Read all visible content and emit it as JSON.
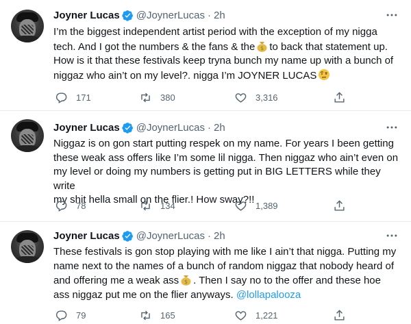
{
  "tweets": [
    {
      "author": "Joyner Lucas",
      "handle": "@JoynerLucas",
      "separator": "·",
      "time": "2h",
      "line1": "I’m the biggest independent artist period with the exception of my nigga",
      "line2_pre": "tech. And I got the numbers & the fans & the",
      "line2_post": "to back that statement up.",
      "line3": "How is it that these festivals keep tryna bunch my name up with a bunch of",
      "line4": "niggaz who ain’t on my level?. nigga I’m JOYNER LUCAS",
      "replies": "171",
      "retweets": "380",
      "likes": "3,316"
    },
    {
      "author": "Joyner Lucas",
      "handle": "@JoynerLucas",
      "separator": "·",
      "time": "2h",
      "line1": "Niggaz is on gon start putting respek on my name. For years I been getting",
      "line2": "these weak ass offers like I’m some lil nigga. Then niggaz who ain’t even on",
      "line3": "my level or doing my numbers is getting put in BIG LETTERS while they write",
      "line4": "my shit hella small on the flier.! How sway?!!",
      "replies": "78",
      "retweets": "134",
      "likes": "1,389"
    },
    {
      "author": "Joyner Lucas",
      "handle": "@JoynerLucas",
      "separator": "·",
      "time": "2h",
      "line1": "These festivals is gon stop playing with me like I ain’t that nigga. Putting my",
      "line2": "name next to the names of a bunch of random niggaz that nobody heard of",
      "line3_pre": "and offering me a weak ass",
      "line3_post": ". Then I say no to the offer and these hoe",
      "line4_pre": "ass niggaz put me on the flier anyways.",
      "mention": "@lollapalooza",
      "replies": "79",
      "retweets": "165",
      "likes": "1,221"
    }
  ],
  "icons": {
    "avatar": "profile-photo",
    "verified": "verified-badge-icon",
    "more": "more-icon",
    "reply": "reply-icon",
    "retweet": "retweet-icon",
    "like": "like-icon",
    "share": "share-icon",
    "money_bag": "money-bag-emoji",
    "raised_eyebrow": "raised-eyebrow-emoji"
  },
  "colors": {
    "text": "#0f1419",
    "secondary": "#536471",
    "accent": "#1d9bf0",
    "divider": "#e6ecf0"
  }
}
